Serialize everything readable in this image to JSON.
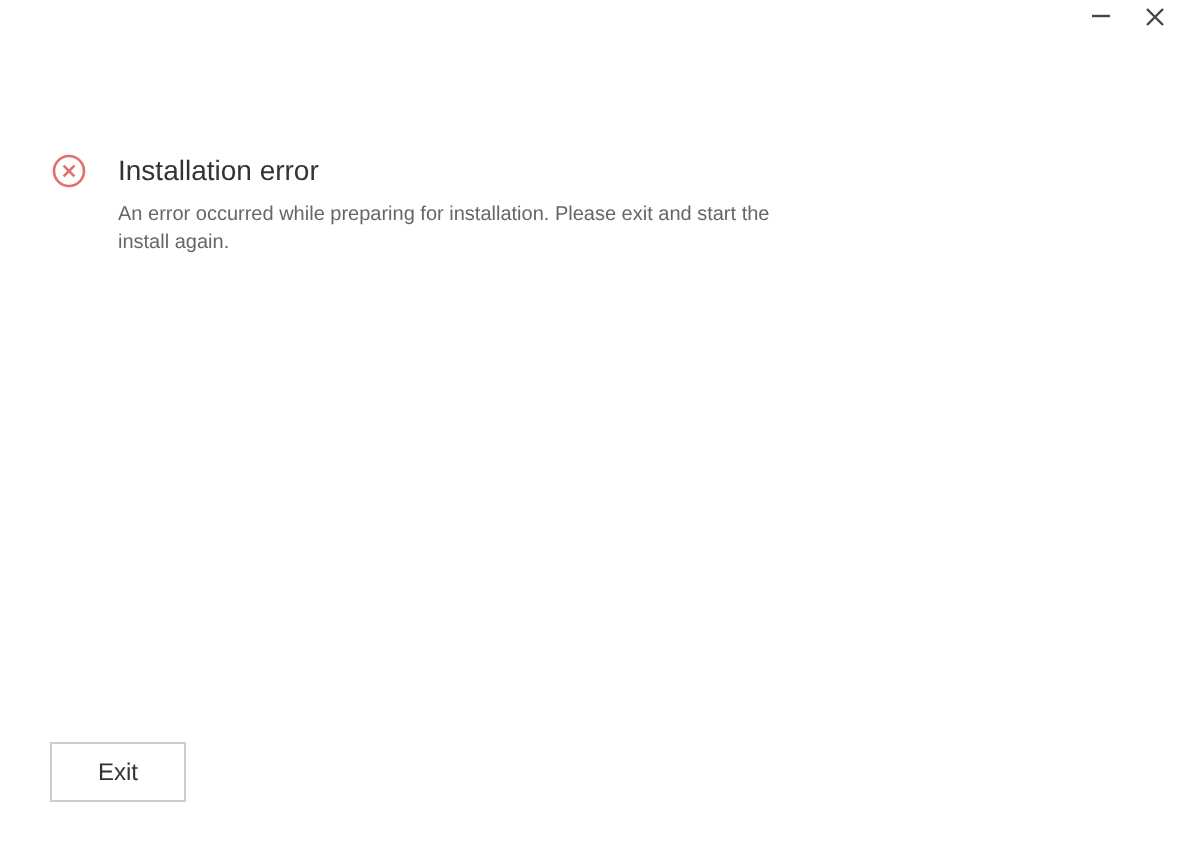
{
  "title_bar": {
    "controls": [
      {
        "kind": "minimize"
      },
      {
        "kind": "close"
      }
    ]
  },
  "error": {
    "title": "Installation error",
    "message": "An error occurred while preparing for installation. Please exit and start the install again."
  },
  "buttons": [
    {
      "label": "Exit"
    }
  ]
}
